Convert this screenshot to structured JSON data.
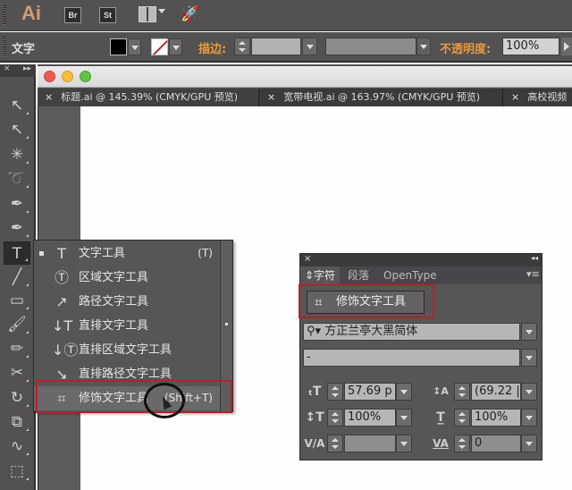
{
  "app": {
    "logo": "Ai",
    "bridge_label": "Br",
    "stock_label": "St",
    "icons": [
      "arrange-documents-icon",
      "rocket-icon"
    ]
  },
  "control_bar": {
    "label": "文字",
    "fill_color": "#000000",
    "stroke_color": "none",
    "stroke_label": "描边:",
    "stroke_weight": "",
    "stroke_style": "",
    "opacity_label": "不透明度:",
    "opacity_value": "100%",
    "accent_color": "#e89a3c"
  },
  "document": {
    "tabs": [
      {
        "label": "标题.ai @ 145.39% (CMYK/GPU 预览)"
      },
      {
        "label": "宽带电视.ai @ 163.97% (CMYK/GPU 预览)"
      },
      {
        "label": "高校视频"
      }
    ],
    "close_glyph": "×"
  },
  "toolbox": {
    "tools": [
      {
        "name": "selection-tool",
        "glyph": "↖"
      },
      {
        "name": "direct-selection-tool",
        "glyph": "↖"
      },
      {
        "name": "magic-wand-tool",
        "glyph": "✳"
      },
      {
        "name": "lasso-tool",
        "glyph": "➰"
      },
      {
        "name": "pen-tool",
        "glyph": "✒"
      },
      {
        "name": "curvature-tool",
        "glyph": "✒"
      },
      {
        "name": "type-tool",
        "glyph": "T"
      },
      {
        "name": "line-tool",
        "glyph": "╱"
      },
      {
        "name": "rectangle-tool",
        "glyph": "▭"
      },
      {
        "name": "paintbrush-tool",
        "glyph": "🖌"
      },
      {
        "name": "pencil-tool",
        "glyph": "✏"
      },
      {
        "name": "scissors-tool",
        "glyph": "✂"
      },
      {
        "name": "rotate-tool",
        "glyph": "↻"
      },
      {
        "name": "scale-tool",
        "glyph": "⧉"
      },
      {
        "name": "warp-tool",
        "glyph": "∿"
      },
      {
        "name": "free-transform-tool",
        "glyph": "⬚"
      }
    ]
  },
  "type_flyout": {
    "items": [
      {
        "label": "文字工具",
        "shortcut": "(T)",
        "icon": "T",
        "selected": true
      },
      {
        "label": "区域文字工具",
        "shortcut": "",
        "icon": "Ⓣ",
        "selected": false
      },
      {
        "label": "路径文字工具",
        "shortcut": "",
        "icon": "↗",
        "selected": false
      },
      {
        "label": "直排文字工具",
        "shortcut": "",
        "icon": "↓T",
        "selected": false
      },
      {
        "label": "直排区域文字工具",
        "shortcut": "",
        "icon": "↓Ⓣ",
        "selected": false
      },
      {
        "label": "直排路径文字工具",
        "shortcut": "",
        "icon": "↘",
        "selected": false
      },
      {
        "label": "修饰文字工具",
        "shortcut": "(Shift+T)",
        "icon": "⌗",
        "selected": false
      }
    ],
    "highlight_color": "#b8202a"
  },
  "character_panel": {
    "close_glyph": "×",
    "collapse_glyph": "◂◂",
    "tabs": [
      {
        "label": "⇕字符",
        "active": true
      },
      {
        "label": "段落",
        "active": false
      },
      {
        "label": "OpenType",
        "active": false
      }
    ],
    "menu_glyph": "▾≡",
    "touch_type_button": "修饰文字工具",
    "font_family": "方正兰亭大黑简体",
    "font_search_glyph": "⚲▾",
    "font_style": "-",
    "font_size": "57.69 p",
    "leading": "(69.22 |",
    "vertical_scale": "100%",
    "horizontal_scale": "100%",
    "kerning": "",
    "tracking": "0"
  }
}
